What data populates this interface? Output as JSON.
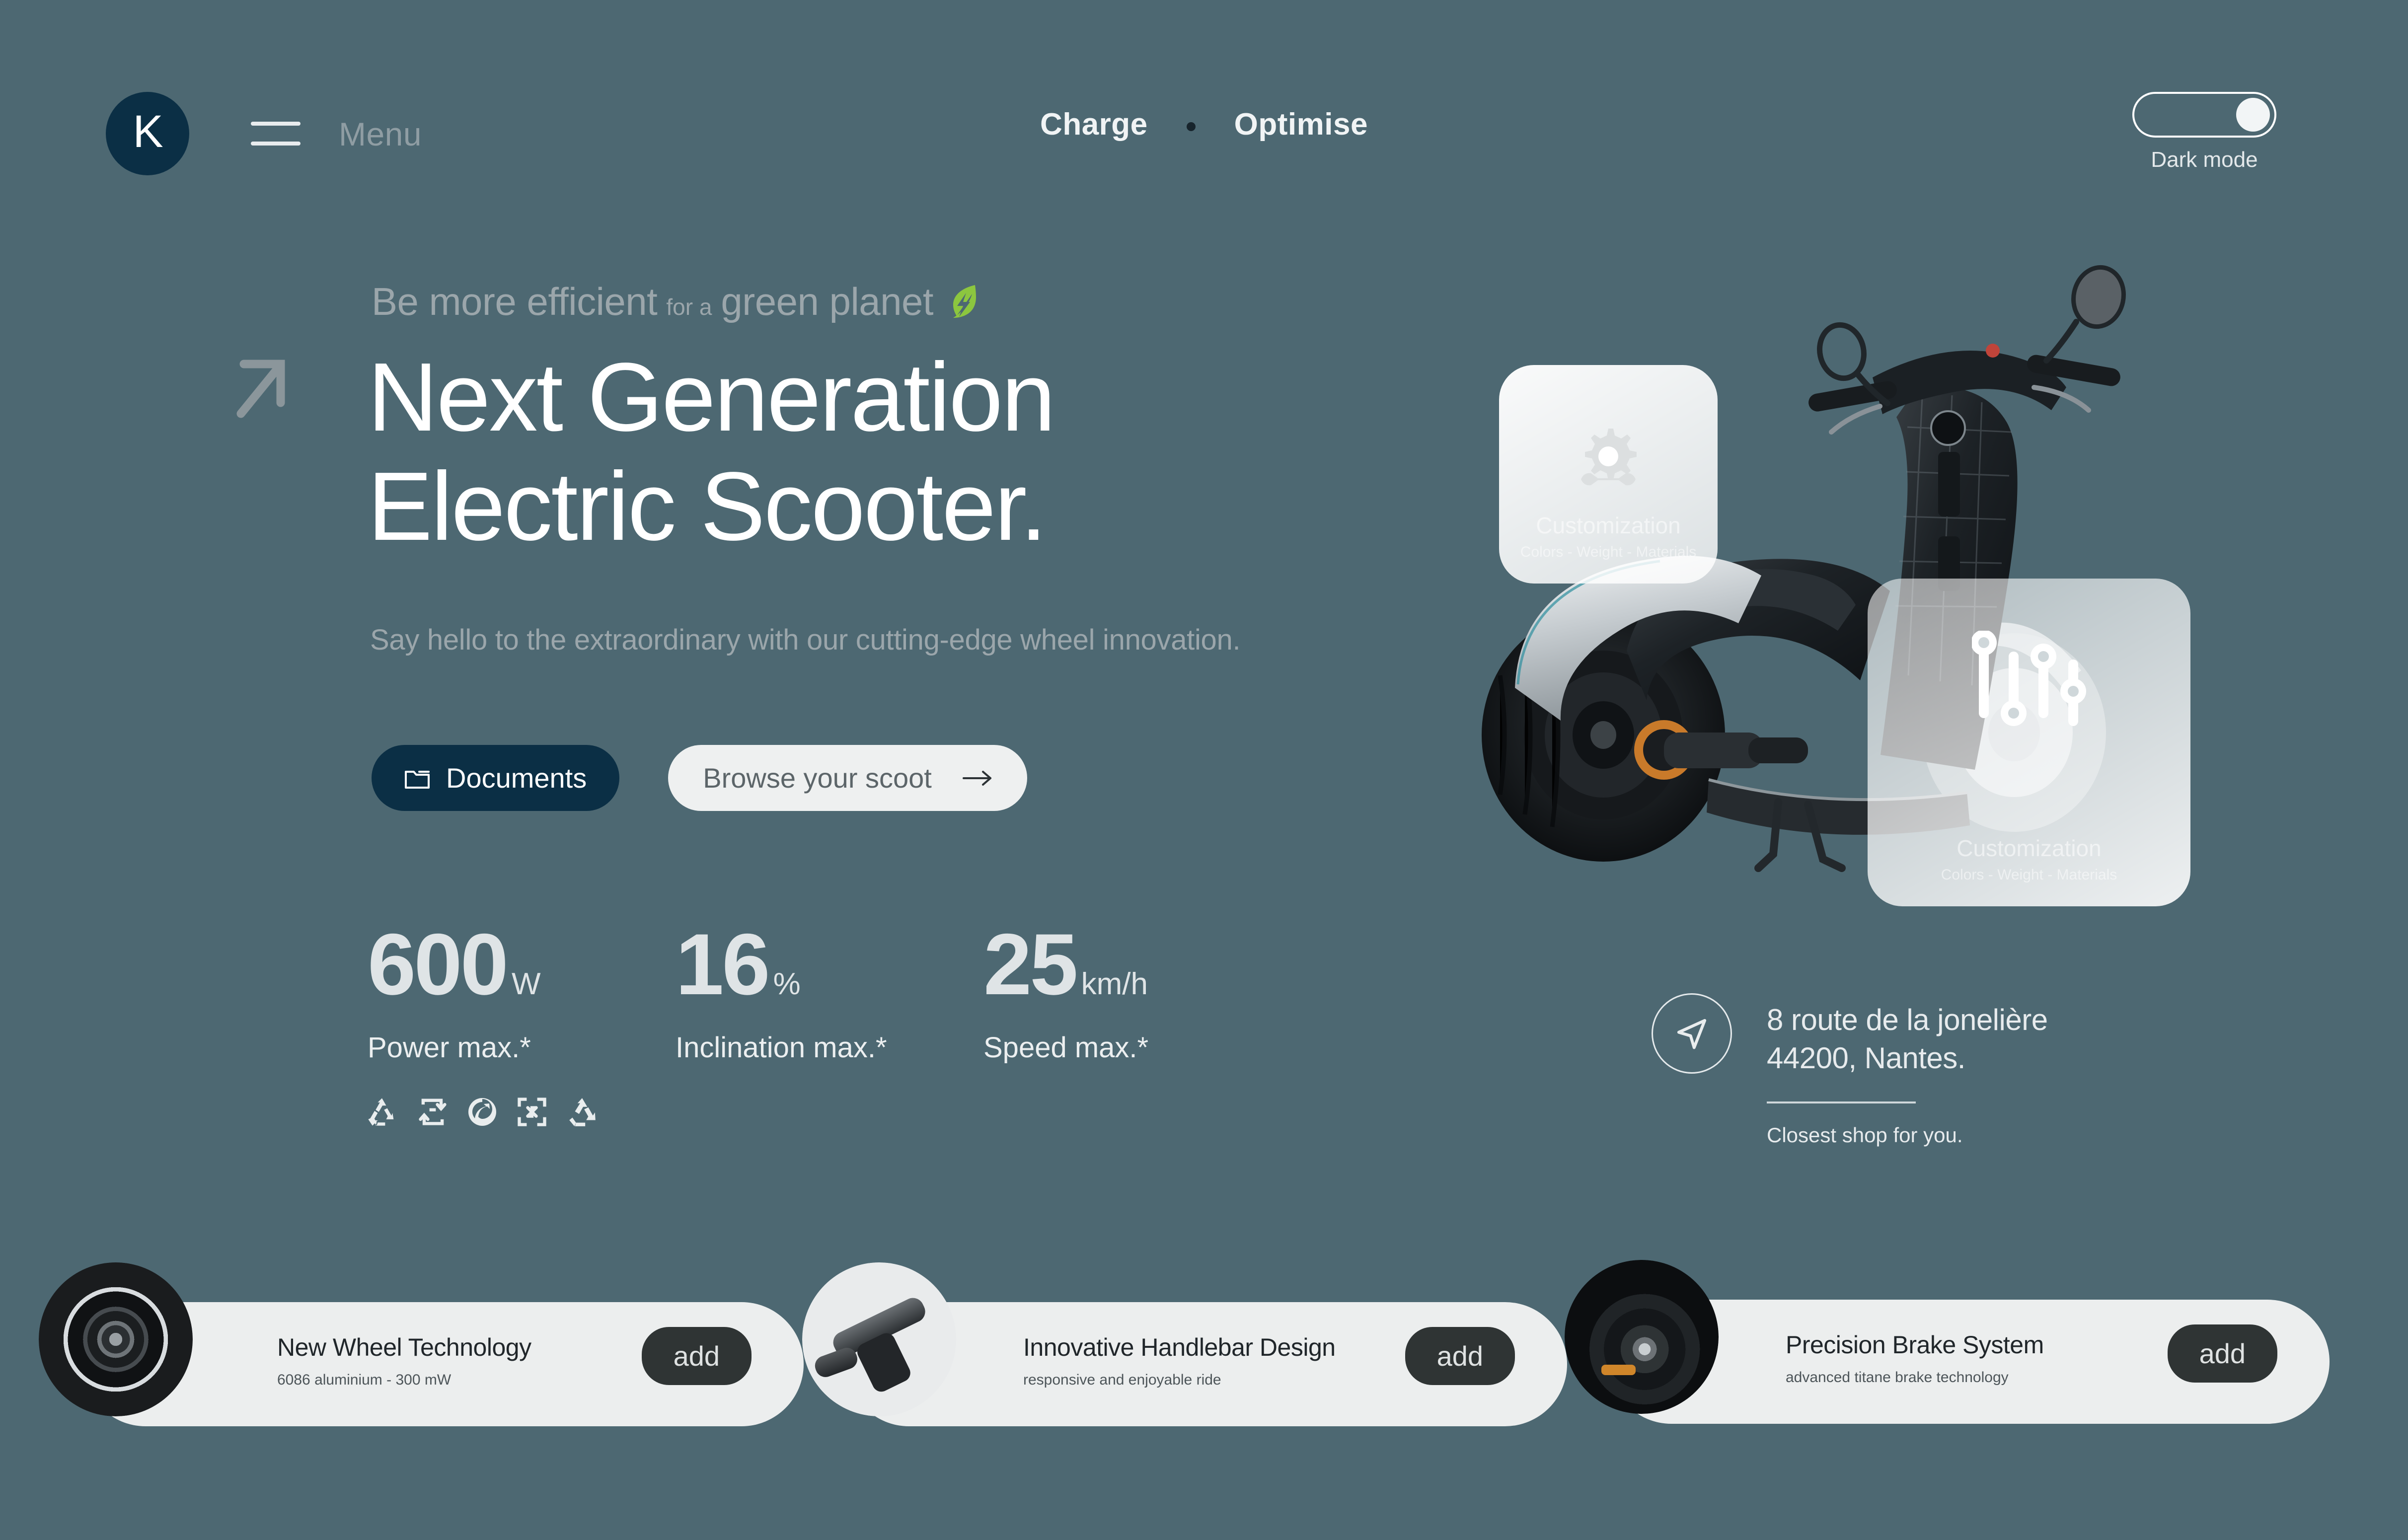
{
  "theme": {
    "background": "#4d6872",
    "accent_dark": "#0b2f45",
    "leaf_green": "#8cc63f",
    "card_light": "#eceeee",
    "add_button": "#2f3434"
  },
  "header": {
    "logo_letter": "K",
    "menu_label": "Menu",
    "nav_links": [
      "Charge",
      "Optimise"
    ],
    "darkmode_label": "Dark mode",
    "darkmode_state": "on"
  },
  "hero": {
    "eyebrow_part1": "Be more efficient",
    "eyebrow_small": "for a",
    "eyebrow_part2": "green planet",
    "headline_line1": "Next Generation",
    "headline_line2": "Electric Scooter.",
    "subhead": "Say hello to the extraordinary with our cutting-edge wheel innovation.",
    "cta_primary": "Documents",
    "cta_secondary": "Browse your scoot"
  },
  "stats": [
    {
      "value": "600",
      "unit": "W",
      "label": "Power max.*"
    },
    {
      "value": "16",
      "unit": "%",
      "label": "Inclination max.*"
    },
    {
      "value": "25",
      "unit": "km/h",
      "label": "Speed max.*"
    }
  ],
  "eco_icons": [
    "recycle-triangle-icon",
    "recycle-square-loop-icon",
    "recycle-circle-arrow-icon",
    "recycle-box-arrows-icon",
    "recycle-mobius-icon"
  ],
  "location": {
    "address_line1": "8 route de la jonelière",
    "address_line2": "44200, Nantes.",
    "caption": "Closest shop for you."
  },
  "float_cards": [
    {
      "icon": "gear-wrench-icon",
      "title": "Customization",
      "subtitle": "Colors - Weight - Materials"
    },
    {
      "icon": "sliders-icon",
      "title": "Customization",
      "subtitle": "Colors - Weight - Materials"
    }
  ],
  "products": [
    {
      "thumb": "wheel-thumbnail",
      "title": "New Wheel Technology",
      "desc": "6086 aluminium - 300 mW",
      "button": "add"
    },
    {
      "thumb": "handlebar-thumbnail",
      "title": "Innovative Handlebar Design",
      "desc": "responsive and enjoyable ride",
      "button": "add"
    },
    {
      "thumb": "brake-thumbnail",
      "title": "Precision Brake System",
      "desc": "advanced titane brake technology",
      "button": "add"
    }
  ]
}
